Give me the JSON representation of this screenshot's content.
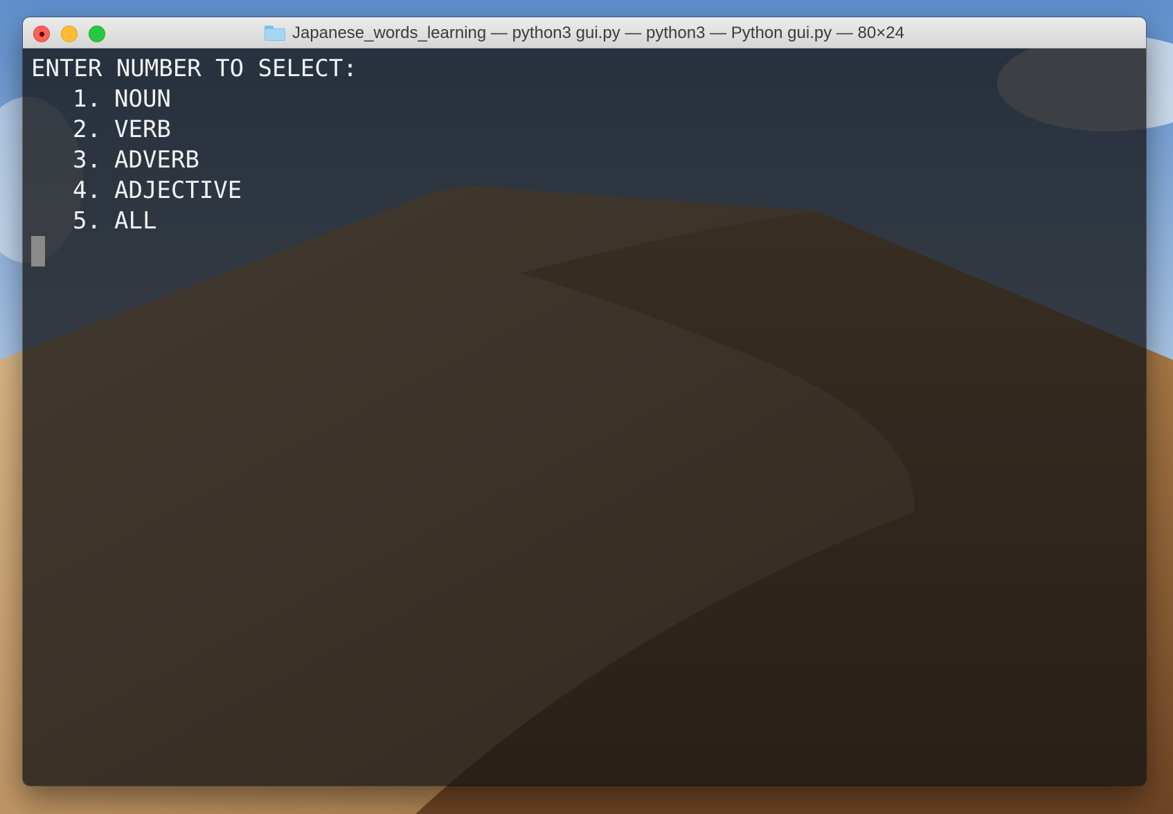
{
  "window": {
    "title": "Japanese_words_learning — python3 gui.py — python3 — Python gui.py — 80×24"
  },
  "terminal": {
    "prompt": "ENTER NUMBER TO SELECT:",
    "options": [
      {
        "number": "1.",
        "label": "NOUN"
      },
      {
        "number": "2.",
        "label": "VERB"
      },
      {
        "number": "3.",
        "label": "ADVERB"
      },
      {
        "number": "4.",
        "label": "ADJECTIVE"
      },
      {
        "number": "5.",
        "label": "ALL"
      }
    ]
  },
  "colors": {
    "close": "#fe5f57",
    "minimize": "#febc2e",
    "zoom": "#28c840",
    "terminal_text": "#f2f2f2"
  },
  "icons": {
    "title_folder": "folder-icon",
    "wallpaper": "desert-dunes"
  }
}
